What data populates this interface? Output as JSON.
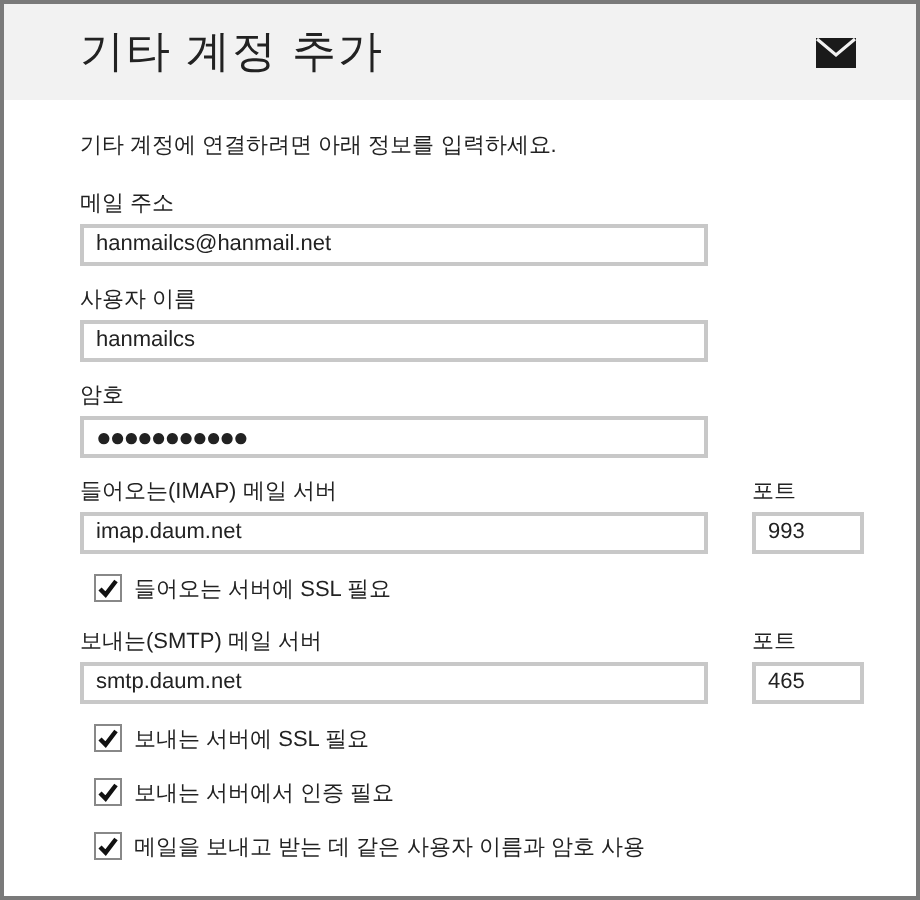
{
  "header": {
    "title": "기타 계정 추가"
  },
  "intro": "기타 계정에 연결하려면 아래 정보를 입력하세요.",
  "rows": [
    {
      "kind": "field",
      "label": "메일 주소",
      "value": "hanmailcs@hanmail.net"
    },
    {
      "kind": "field",
      "label": "사용자 이름",
      "value": "hanmailcs"
    },
    {
      "kind": "field",
      "label": "암호",
      "value": "●●●●●●●●●●●"
    },
    {
      "kind": "server",
      "label": "들어오는(IMAP) 메일 서버",
      "value": "imap.daum.net",
      "port_label": "포트",
      "port": "993"
    },
    {
      "kind": "checkbox",
      "label": "들어오는 서버에 SSL 필요",
      "checked": true
    },
    {
      "kind": "server",
      "label": "보내는(SMTP) 메일 서버",
      "value": "smtp.daum.net",
      "port_label": "포트",
      "port": "465"
    },
    {
      "kind": "checkbox",
      "label": "보내는 서버에 SSL 필요",
      "checked": true
    },
    {
      "kind": "checkbox",
      "label": "보내는 서버에서 인증 필요",
      "checked": true
    },
    {
      "kind": "checkbox",
      "label": "메일을 보내고 받는 데 같은 사용자 이름과 암호 사용",
      "checked": true
    }
  ]
}
